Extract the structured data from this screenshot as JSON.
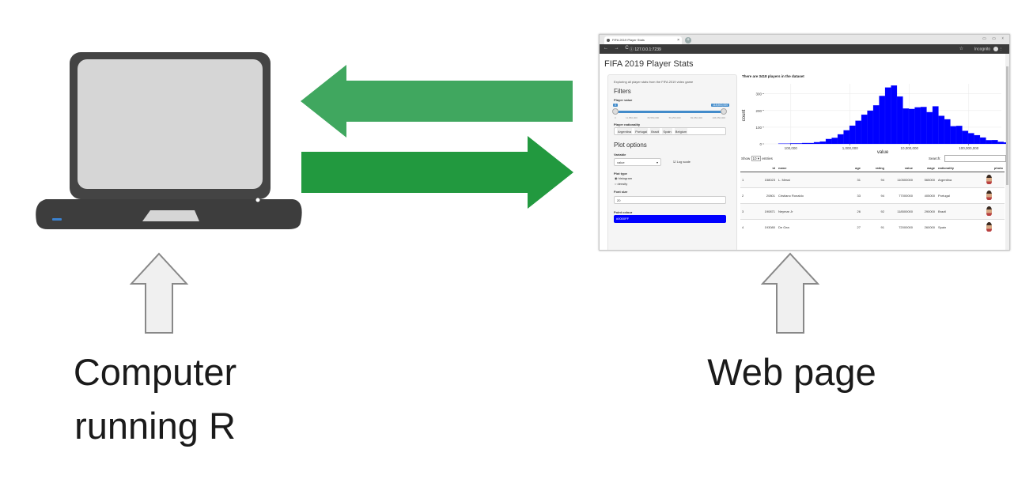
{
  "captions": {
    "left": "Computer\nrunning R",
    "right": "Web page"
  },
  "colors": {
    "arrow_left": "#40a75f",
    "arrow_right": "#22993f",
    "up_arrow_fill": "#f0f0f0",
    "up_arrow_stroke": "#888888",
    "laptop_body": "#444444",
    "laptop_screen": "#d6d6d6",
    "laptop_base": "#3d3d3d",
    "laptop_led": "#3b82d0",
    "hist_bar": "#0000ff"
  },
  "browser": {
    "tab_title": "FIFA 2019 Player Stats",
    "tab_close": "×",
    "new_tab": "+",
    "window_controls": "▭ ▭ ☓",
    "nav": "← → C",
    "url": "ⓘ 127.0.0.1:7239",
    "star": "☆",
    "incognito_label": "Incognito",
    "menu_dots": "⋮",
    "app": {
      "title": "FIFA 2019 Player Stats",
      "description": "Exploring all player stats from the FIFA 2019 video game",
      "filters_heading": "Filters",
      "player_value_label": "Player value",
      "slider_min_badge": "0",
      "slider_max_badge": "118,500,000",
      "slider_ticks": [
        "0",
        "11,850,000",
        "35,550,000",
        "59,250,000",
        "82,950,000",
        "106,650,000"
      ],
      "nationality_label": "Player nationality",
      "nationality_chips": [
        "Argentina",
        "Portugal",
        "Brazil",
        "Spain",
        "Belgium"
      ],
      "plot_options_heading": "Plot options",
      "variable_label": "Variable",
      "variable_value": "value",
      "select_caret": "▾",
      "log_scale_label": "☑ Log scale",
      "plot_type_label": "Plot type",
      "plot_types": [
        "◉ histogram",
        "○ density"
      ],
      "font_size_label": "Font size",
      "font_size_value": "20",
      "point_colour_label": "Point colour",
      "point_colour_value": "#0000FF",
      "plot_caption": "There are 3418 players in the dataset",
      "show_label": "Show",
      "show_value": "10 ▾",
      "entries_label": "entries",
      "search_label": "Search:"
    },
    "table": {
      "columns": [
        "",
        "id",
        "name",
        "age",
        "rating",
        "value",
        "wage",
        "nationality",
        "photo"
      ],
      "rows": [
        [
          "1",
          "158023",
          "L. Messi",
          "31",
          "94",
          "110500000",
          "565000",
          "Argentina"
        ],
        [
          "2",
          "20801",
          "Cristiano Ronaldo",
          "33",
          "94",
          "77000000",
          "405000",
          "Portugal"
        ],
        [
          "3",
          "190871",
          "Neymar Jr",
          "26",
          "92",
          "118500000",
          "290000",
          "Brazil"
        ],
        [
          "4",
          "193080",
          "De Gea",
          "27",
          "91",
          "72000000",
          "260000",
          "Spain"
        ]
      ]
    }
  },
  "chart_data": {
    "type": "bar",
    "title": "",
    "xlabel": "value",
    "ylabel": "count",
    "x_scale": "log10",
    "x_ticks": [
      100000,
      1000000,
      10000000,
      100000000
    ],
    "x_tick_labels": [
      "100,000",
      "1,000,000",
      "10,000,000",
      "100,000,000"
    ],
    "y_ticks": [
      0,
      100,
      200,
      300
    ],
    "ylim": [
      0,
      360
    ],
    "bin_log10_start": 4.79,
    "bin_log10_width": 0.1,
    "values": [
      2,
      2,
      3,
      3,
      5,
      5,
      10,
      14,
      29,
      36,
      57,
      81,
      109,
      139,
      175,
      199,
      231,
      287,
      338,
      350,
      284,
      212,
      209,
      219,
      221,
      190,
      225,
      168,
      147,
      106,
      108,
      78,
      64,
      52,
      38,
      22,
      23,
      12,
      9,
      5,
      3,
      2
    ]
  }
}
